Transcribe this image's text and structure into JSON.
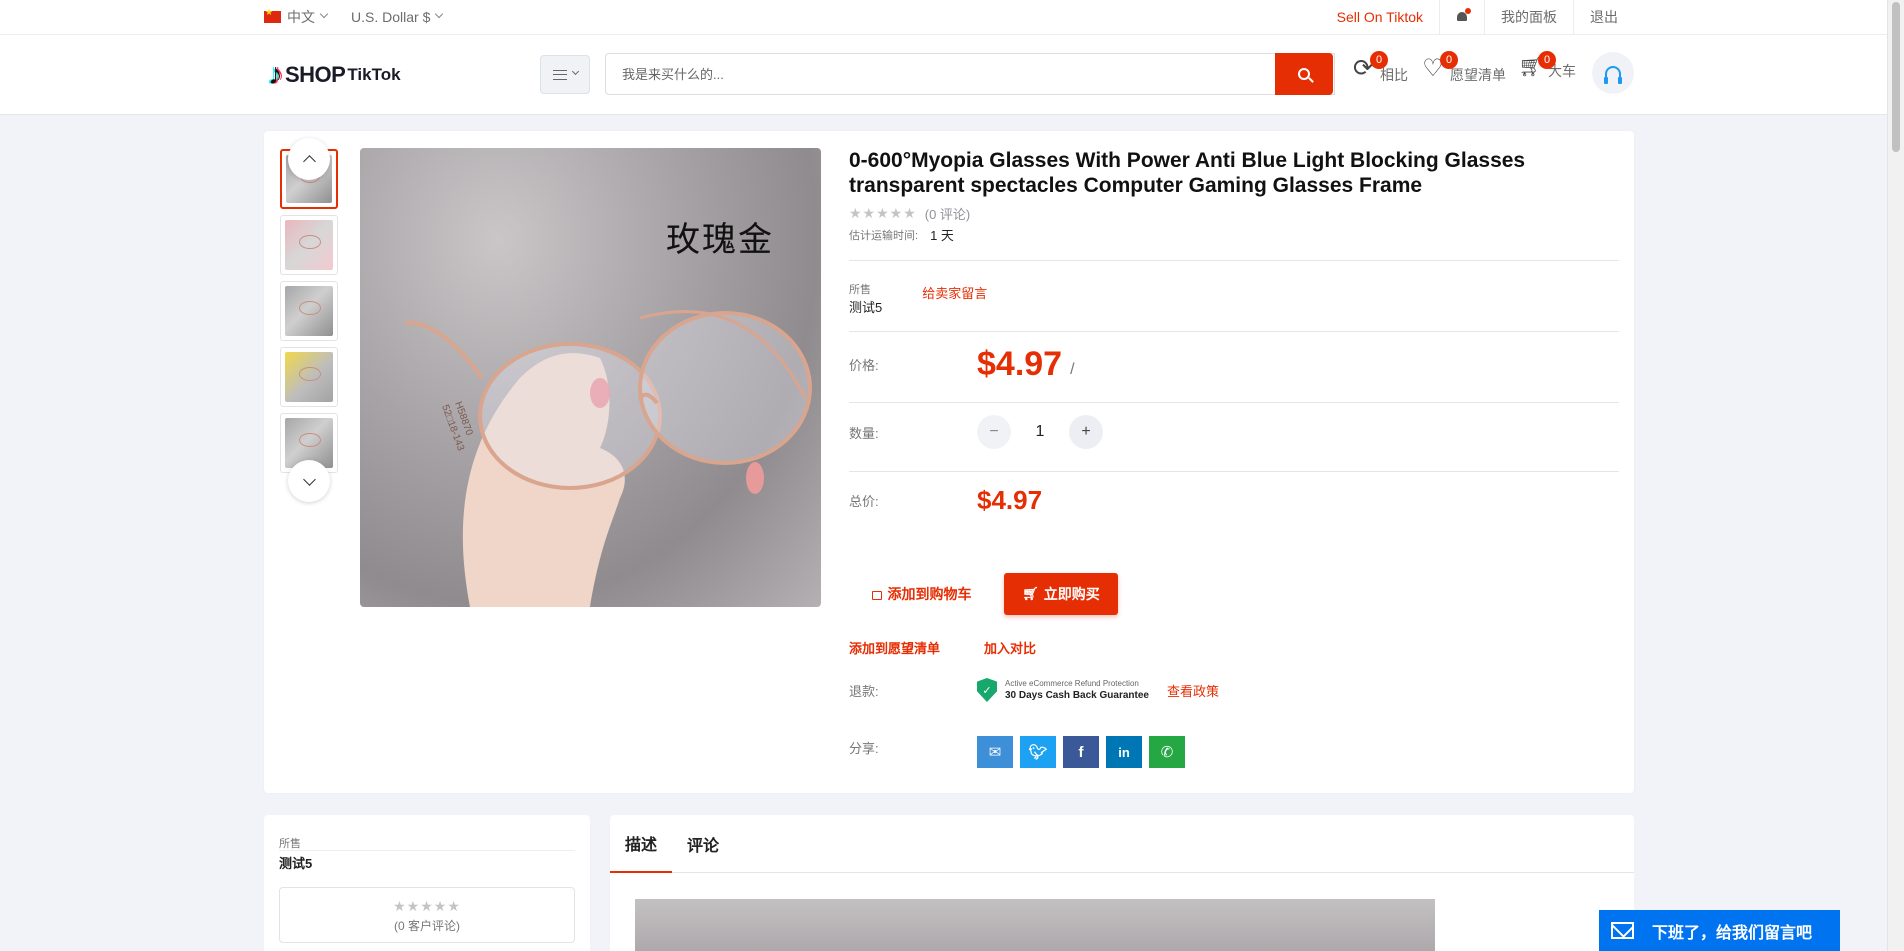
{
  "topbar": {
    "language": "中文",
    "currency": "U.S. Dollar $",
    "sell_link": "Sell On Tiktok",
    "dashboard": "我的面板",
    "logout": "退出"
  },
  "header": {
    "logo_shop": "SHOP",
    "logo_tiktok": "TikTok",
    "search_placeholder": "我是来买什么的...",
    "compare": {
      "label": "相比",
      "count": "0"
    },
    "wishlist": {
      "label": "愿望清单",
      "count": "0"
    },
    "cart": {
      "label": "大车",
      "count": "0"
    }
  },
  "product": {
    "title": "0-600°Myopia Glasses With Power Anti Blue Light Blocking Glasses transparent spectacles Computer Gaming Glasses Frame",
    "stars": "★★★★★",
    "reviews": "(0 评论)",
    "ship_label": "估计运输时间:",
    "ship_value": "1 天",
    "sold_by_label": "所售",
    "seller_name": "测试5",
    "message_seller": "给卖家留言",
    "price_label": "价格:",
    "price": "$4.97",
    "price_unit": "/",
    "qty_label": "数量:",
    "qty_minus": "−",
    "qty_value": "1",
    "qty_plus": "+",
    "total_label": "总价:",
    "total": "$4.97",
    "add_to_cart": "添加到购物车",
    "buy_now": "立即购买",
    "add_wishlist": "添加到愿望清单",
    "add_compare": "加入对比",
    "refund_label": "退款:",
    "refund_small": "Active eCommerce Refund Protection",
    "refund_big": "30 Days Cash Back Guarantee",
    "view_policy": "查看政策",
    "share_label": "分享:",
    "image_text": "玫瑰金",
    "image_frame_text_1": "H58870",
    "image_frame_text_2": "52□18-143"
  },
  "share_colors": {
    "email": "#3d8fd8",
    "twitter": "#1da1f2",
    "facebook": "#3b5998",
    "linkedin": "#0077b5",
    "whatsapp": "#25a844"
  },
  "seller_panel": {
    "label": "所售",
    "name": "测试5",
    "stars": "★★★★★",
    "reviews": "(0 客户评论)"
  },
  "tabs": [
    "描述",
    "评论"
  ],
  "chat": {
    "text": "下班了，给我们留言吧"
  },
  "colors": {
    "accent": "#e62e04",
    "chat": "#0073f0"
  }
}
